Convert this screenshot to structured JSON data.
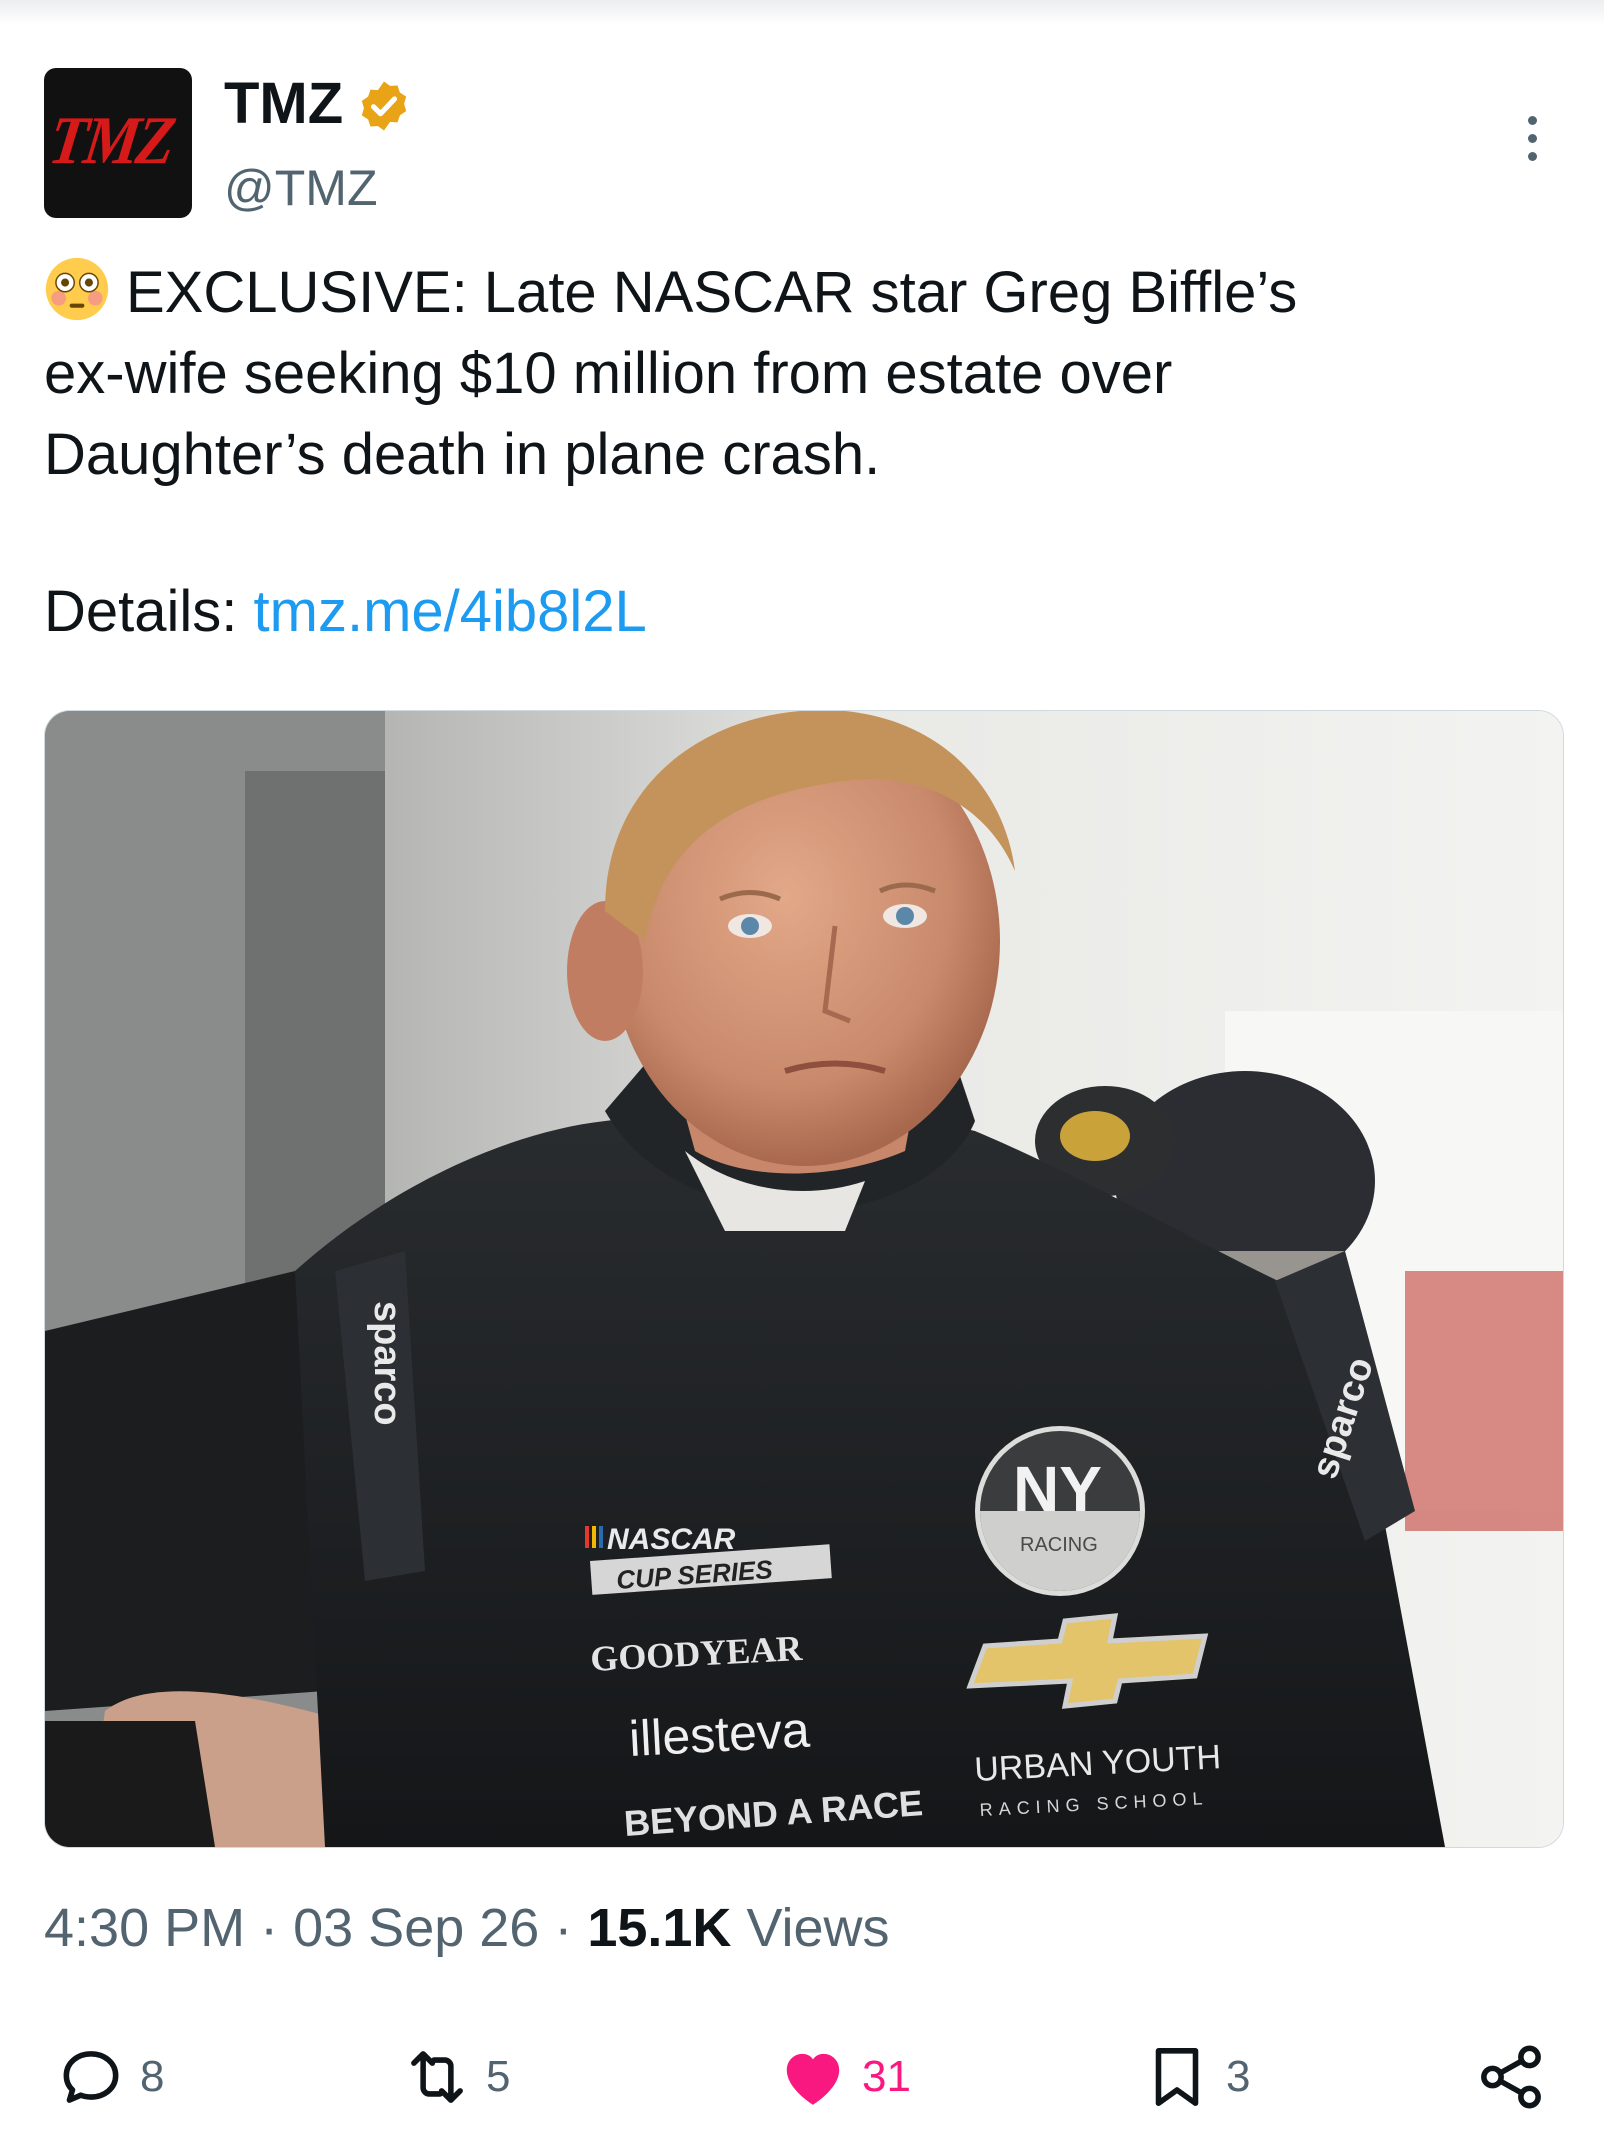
{
  "account": {
    "avatar_text": "TMZ",
    "name": "TMZ",
    "handle": "@TMZ",
    "verified": true,
    "verified_color": "#e8a317"
  },
  "tweet": {
    "emoji": "flushed-face",
    "lines": [
      "EXCLUSIVE: Late NASCAR star Greg Biffle’s",
      "ex-wife seeking $10 million from estate over",
      "Daughter’s death in plane crash."
    ],
    "details_label": "Details:",
    "link_text": "tmz.me/4ib8l2L",
    "link_color": "#1d9bf0"
  },
  "media": {
    "suit_texts": {
      "sparco": "sparco",
      "nascar": "NASCAR",
      "cup_series": "CUP SERIES",
      "goodyear": "GOODYEAR",
      "illesteva": "illesteva",
      "beyond": "BEYOND A RACE",
      "ny": "NY",
      "racing": "RACING",
      "urban_youth": "URBAN YOUTH",
      "racing_school": "RACING SCHOOL"
    }
  },
  "meta": {
    "time": "4:30 PM",
    "date": "03 Sep 26",
    "views_count": "15.1K",
    "views_label": "Views"
  },
  "actions": {
    "replies": "8",
    "reposts": "5",
    "likes": "31",
    "bookmarks": "3",
    "like_color": "#f91880"
  }
}
